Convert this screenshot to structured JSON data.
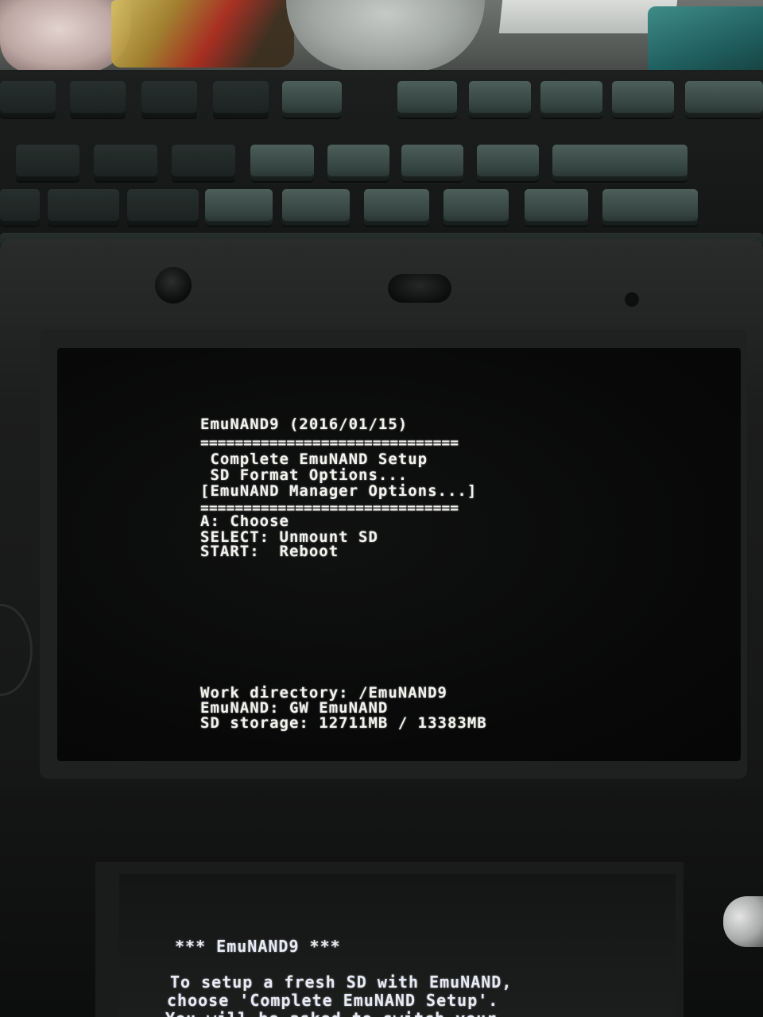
{
  "top_screen": {
    "title": "EmuNAND9 (2016/01/15)",
    "separator_top": "==============================",
    "menu_items": [
      " Complete EmuNAND Setup",
      " SD Format Options...",
      "[EmuNAND Manager Options...]"
    ],
    "separator_bottom": "==============================",
    "controls": [
      "A: Choose",
      "SELECT: Unmount SD",
      "START:  Reboot"
    ],
    "status": {
      "work_directory": "Work directory: /EmuNAND9",
      "emunand": "EmuNAND: GW EmuNAND",
      "sd_storage": "SD storage: 12711MB / 13383MB"
    }
  },
  "bottom_screen": {
    "header": "*** EmuNAND9 ***",
    "lines": [
      "To setup a fresh SD with EmuNAND,",
      "choose 'Complete EmuNAND Setup'.",
      "You will be asked to switch your"
    ]
  }
}
